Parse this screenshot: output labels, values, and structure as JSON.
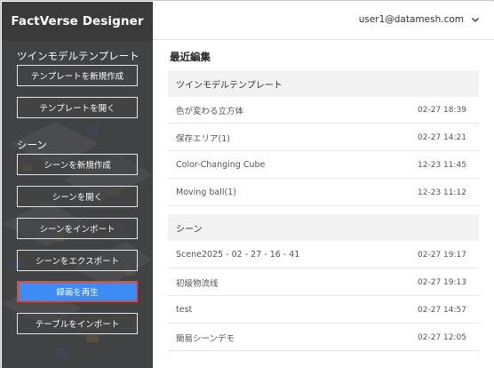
{
  "app": {
    "title": "FactVerse Designer"
  },
  "header": {
    "user": "user1@datamesh.com"
  },
  "sidebar": {
    "template_heading": "ツインモデルテンプレート",
    "template_buttons": [
      {
        "label": "テンプレートを新規作成"
      },
      {
        "label": "テンプレートを開く"
      }
    ],
    "scene_heading": "シーン",
    "scene_buttons": [
      {
        "label": "シーンを新規作成"
      },
      {
        "label": "シーンを開く"
      },
      {
        "label": "シーンをインポート"
      },
      {
        "label": "シーンをエクスポート"
      },
      {
        "label": "録画を再生",
        "active": true
      },
      {
        "label": "テーブルをインポート"
      }
    ]
  },
  "main": {
    "title": "最近編集",
    "sections": [
      {
        "heading": "ツインモデルテンプレート",
        "items": [
          {
            "name": "色が変わる立方体",
            "date": "02-27 18:39"
          },
          {
            "name": "保存エリア(1)",
            "date": "02-27 14:21"
          },
          {
            "name": "Color-Changing Cube",
            "date": "12-23 11:45"
          },
          {
            "name": "Moving ball(1)",
            "date": "12-23 11:12"
          }
        ]
      },
      {
        "heading": "シーン",
        "items": [
          {
            "name": "Scene2025 - 02 - 27 - 16 - 41",
            "date": "02-27 19:17"
          },
          {
            "name": "初級物流线",
            "date": "02-27 19:13"
          },
          {
            "name": "test",
            "date": "02-27 14:57"
          },
          {
            "name": "簡易シーンデモ",
            "date": "02-27 12:05"
          }
        ]
      }
    ]
  },
  "colors": {
    "sidebar": "#3d3d3d",
    "accent": "#3d8cf5",
    "highlight_border": "#e04a3a"
  },
  "icons": {
    "user_menu": "chevron-down-icon"
  }
}
